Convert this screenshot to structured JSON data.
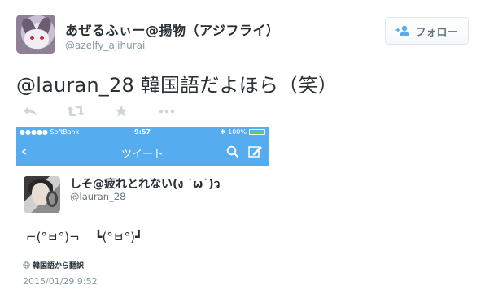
{
  "author": {
    "display_name": "あぜるふぃー@揚物（アジフライ）",
    "screen_name": "@azelfy_ajihurai"
  },
  "follow_button": {
    "label": "フォロー"
  },
  "tweet": {
    "mention": "@lauran_28",
    "text": " 韓国語だよほら（笑）"
  },
  "actions": [
    {
      "icon": "reply-icon"
    },
    {
      "icon": "retweet-icon"
    },
    {
      "icon": "favorite-star-icon"
    },
    {
      "icon": "more-dots-icon"
    }
  ],
  "embedded_screenshot": {
    "status_bar": {
      "carrier": "●●●●● SoftBank",
      "time": "9:57",
      "battery": "100%",
      "battery_level": 1.0
    },
    "nav": {
      "title": "ツイート"
    },
    "inner_tweet": {
      "display_name": "しそ@疲れとれない(ง ˙ω˙)ว",
      "screen_name": "@lauran_28",
      "text": "⌐(°ㅂ°)¬  ┗(°ㅂ°)┛",
      "translate_label": "韓国語から翻訳",
      "date": "2015/01/29 9:52"
    }
  },
  "colors": {
    "twitter_blue": "#55acee",
    "text": "#292f33",
    "muted": "#8899a6",
    "icon_gray": "#ccd6dd"
  }
}
